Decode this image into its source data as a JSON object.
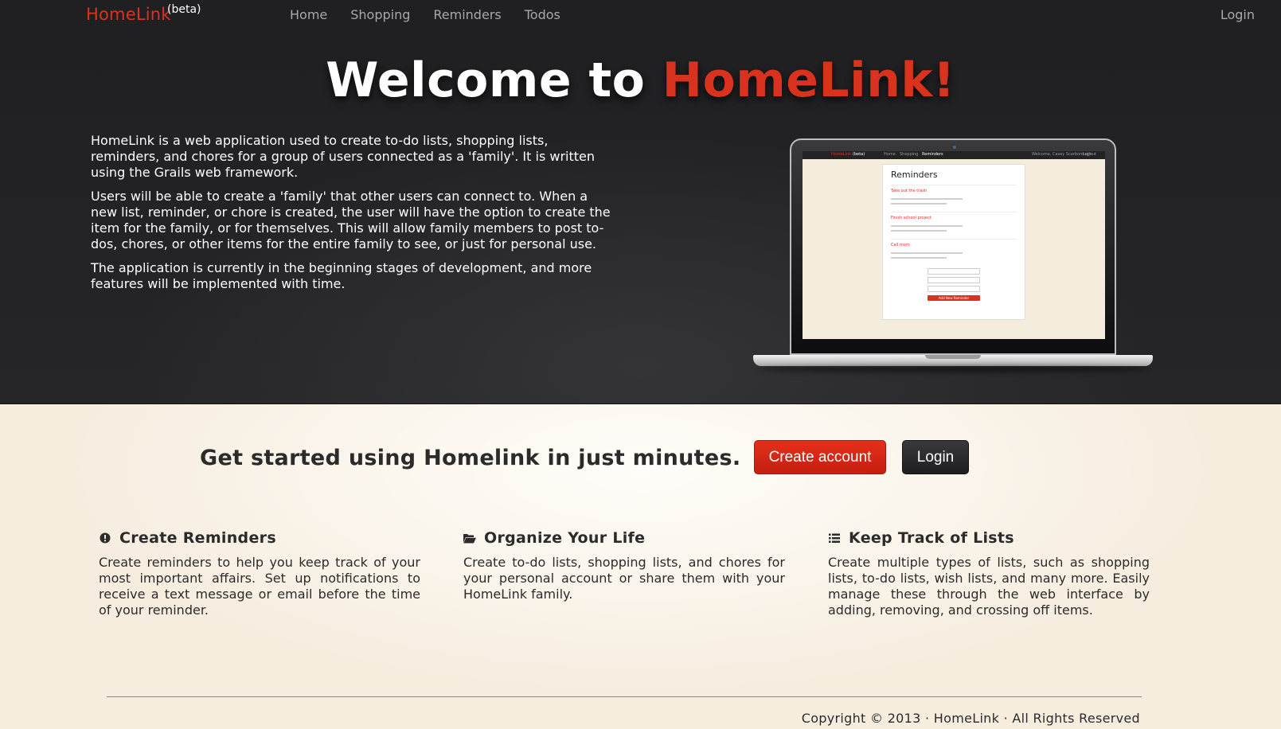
{
  "navbar": {
    "brand": "HomeLink",
    "beta": "(beta)",
    "links": [
      {
        "label": "Home"
      },
      {
        "label": "Shopping"
      },
      {
        "label": "Reminders"
      },
      {
        "label": "Todos"
      }
    ],
    "login": "Login"
  },
  "hero": {
    "title_prefix": "Welcome to ",
    "title_accent": "HomeLink!",
    "paragraphs": [
      "HomeLink is a web application used to create to-do lists, shopping lists, reminders, and chores for a group of users connected as a 'family'. It is written using the Grails web framework.",
      "Users will be able to create a 'family' that other users can connect to. When a new list, reminder, or chore is created, the user will have the option to create the item for the family, or for themselves. This will allow family members to post to-dos, chores, or other items for the entire family to see, or just for personal use.",
      "The application is currently in the beginning stages of development, and more features will be implemented with time."
    ]
  },
  "laptop_screen": {
    "brand": "HomeLink",
    "beta": "(beta)",
    "nav": [
      "Home",
      "Shopping",
      "Reminders"
    ],
    "user": "Welcome, Casey Scarborough",
    "logout": "Logout",
    "card_title": "Reminders",
    "items": [
      {
        "title": "Take out the trash"
      },
      {
        "title": "Finish school project"
      },
      {
        "title": "Call mom"
      }
    ],
    "button": "Add New Reminder"
  },
  "cta": {
    "text": "Get started using Homelink in just minutes.",
    "create_account": "Create account",
    "login": "Login"
  },
  "features": [
    {
      "icon": "exclamation-circle-icon",
      "title": "Create Reminders",
      "text": "Create reminders to help you keep track of your most important affairs. Set up notifications to receive a text message or email before the time of your reminder."
    },
    {
      "icon": "folder-open-icon",
      "title": "Organize Your Life",
      "text": "Create to-do lists, shopping lists, and chores for your personal account or share them with your HomeLink family."
    },
    {
      "icon": "list-icon",
      "title": "Keep Track of Lists",
      "text": "Create multiple types of lists, such as shopping lists, to-do lists, wish lists, and many more. Easily manage these through the web interface by adding, removing, and crossing off items."
    }
  ],
  "footer": {
    "copyright": "Copyright © 2013 · HomeLink · All Rights Reserved"
  },
  "colors": {
    "accent": "#d9331f",
    "navbar": "#202022",
    "page_bg": "#f6eddf"
  }
}
